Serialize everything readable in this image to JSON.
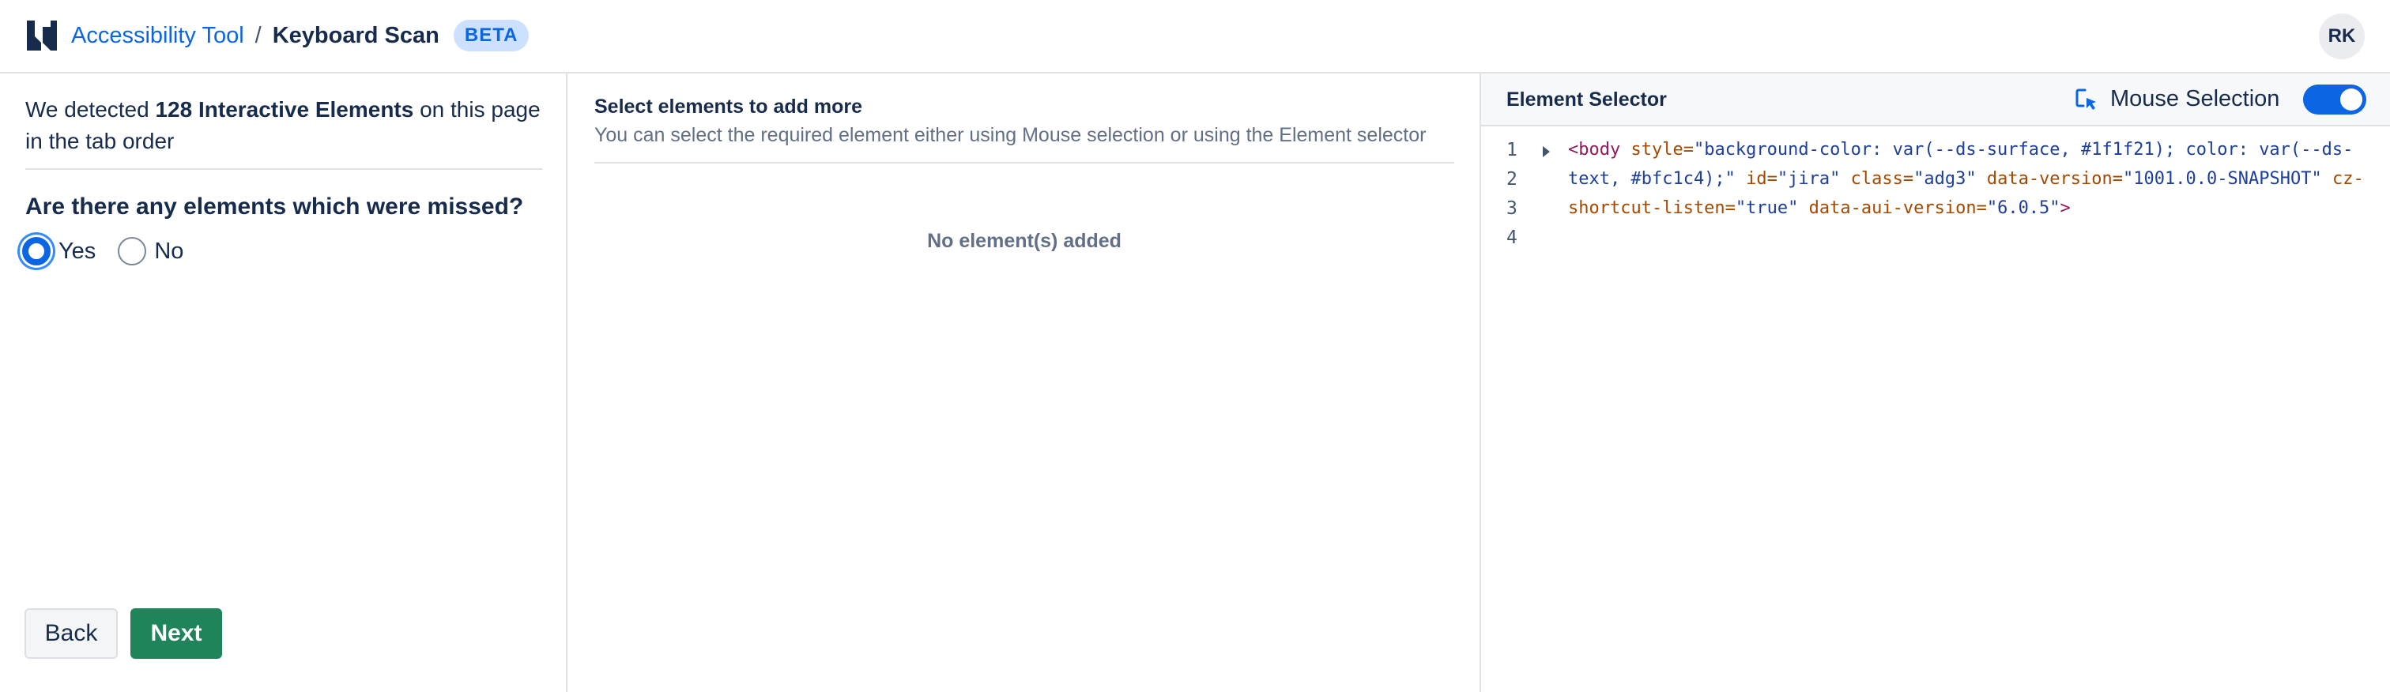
{
  "header": {
    "app_name": "Accessibility Tool",
    "separator": "/",
    "page": "Keyboard Scan",
    "badge": "BETA",
    "avatar_initials": "RK",
    "logo_icon": "jira-logo-icon"
  },
  "left_panel": {
    "detect_prefix": "We detected ",
    "detect_count": "128 Interactive Elements",
    "detect_suffix": " on this page in the tab order",
    "question": "Are there any elements which were missed?",
    "options": [
      {
        "label": "Yes",
        "selected": true
      },
      {
        "label": "No",
        "selected": false
      }
    ],
    "back_label": "Back",
    "next_label": "Next"
  },
  "middle_panel": {
    "title": "Select elements to add more",
    "subtitle": "You can select the required element either using Mouse selection or using the Element selector",
    "empty_text": "No element(s) added"
  },
  "right_panel": {
    "title": "Element Selector",
    "mouse_selection_label": "Mouse Selection",
    "mouse_selection_enabled": true,
    "mouse_icon": "cursor-select-icon",
    "line_numbers": [
      "1",
      "2",
      "3",
      "4"
    ],
    "code": {
      "line1_tag_open": "<body",
      "line1_attr1": " style=",
      "line1_val1": "\"background-color: var(--ds-surface, #1f1f21); color: var(--ds-",
      "line2_val1_cont": "text, #bfc1c4);\"",
      "line2_attr2": " id=",
      "line2_val2": "\"jira\"",
      "line2_attr3": " class=",
      "line2_val3": "\"adg3\"",
      "line2_attr4": " data-version=",
      "line2_val4": "\"1001.0.0-SNAPSHOT\"",
      "line2_attr5": " cz-",
      "line3_attr5_cont": "shortcut-listen=",
      "line3_val5": "\"true\"",
      "line3_attr6": " data-aui-version=",
      "line3_val6": "\"6.0.5\"",
      "line3_tag_close": ">"
    }
  },
  "colors": {
    "accent": "#0c66e4",
    "next_button": "#1f845a",
    "badge_bg": "#cce0ff"
  }
}
